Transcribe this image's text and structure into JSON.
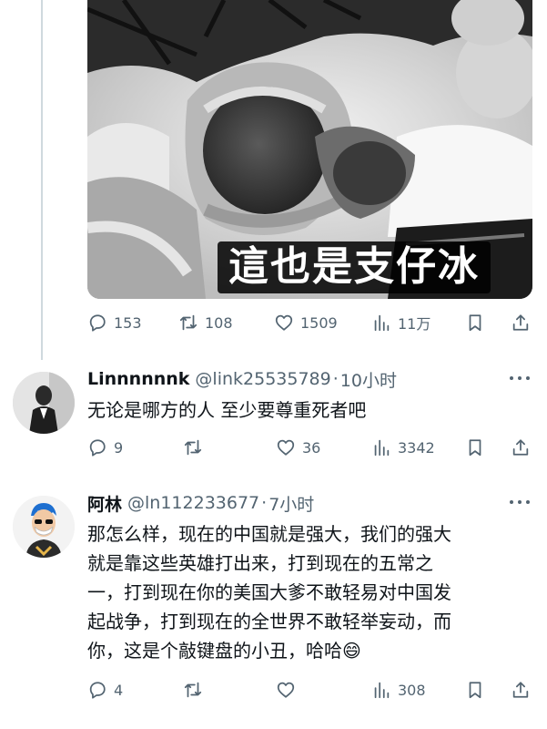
{
  "post": {
    "caption": "這也是支仔冰",
    "stats": {
      "replies": "153",
      "reposts": "108",
      "likes": "1509",
      "views": "11万"
    }
  },
  "replies": [
    {
      "name": "Linnnnnnk",
      "handle": "@link25535789",
      "dot": "·",
      "time": "10小时",
      "text": "无论是哪方的人 至少要尊重死者吧",
      "stats": {
        "replies": "9",
        "reposts": "",
        "likes": "36",
        "views": "3342"
      }
    },
    {
      "name": "阿林",
      "handle": "@ln112233677",
      "dot": "·",
      "time": "7小时",
      "lines": [
        "那怎么样，现在的中国就是强大，我们的强大",
        "就是靠这些英雄打出来，打到现在的五常之",
        "一，打到现在你的美国大爹不敢轻易对中国发",
        "起战争，打到现在的全世界不敢轻举妄动，而",
        "你，这是个敲键盘的小丑，哈哈😄"
      ],
      "stats": {
        "replies": "4",
        "reposts": "",
        "likes": "",
        "views": "308"
      }
    }
  ],
  "colors": {
    "secondary_text": "#536471",
    "primary_text": "#0f1419",
    "thread_line": "#cfd9de"
  },
  "icons": [
    "reply-icon",
    "repost-icon",
    "like-icon",
    "views-icon",
    "bookmark-icon",
    "share-icon",
    "more-icon"
  ]
}
